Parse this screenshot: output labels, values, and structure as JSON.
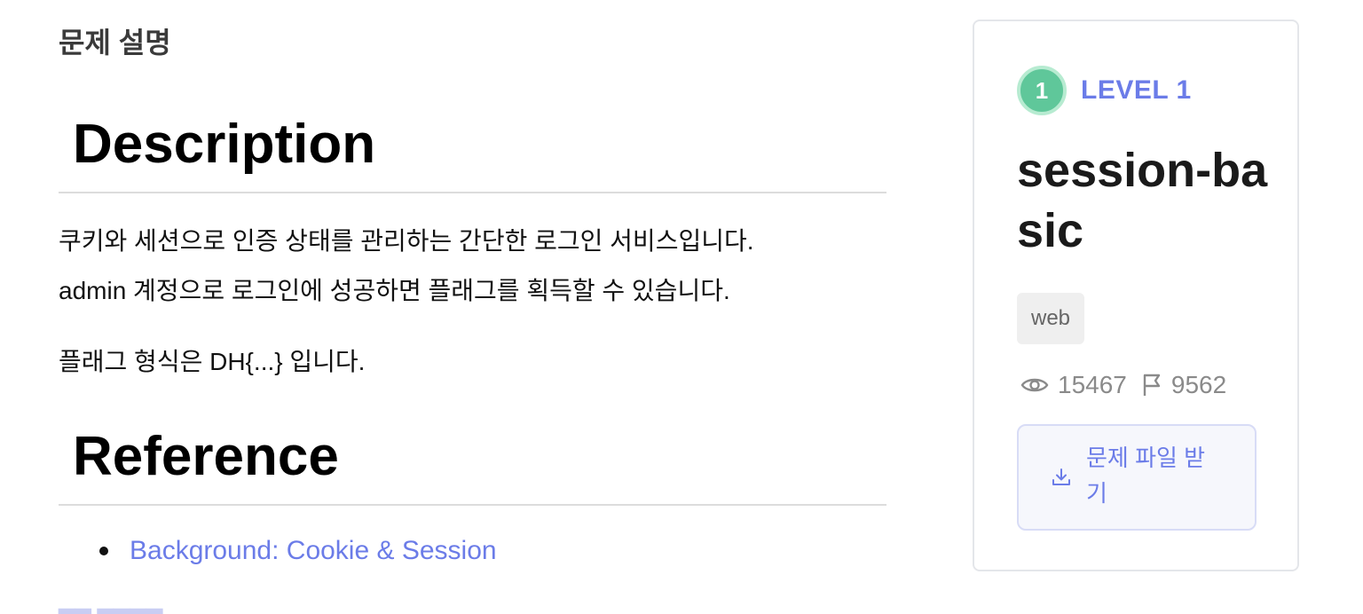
{
  "section_title": "문제 설명",
  "description": {
    "heading": "Description",
    "paragraph1": "쿠키와 세션으로 인증 상태를 관리하는 간단한 로그인 서비스입니다.",
    "paragraph2": "admin 계정으로 로그인에 성공하면 플래그를 획득할 수 있습니다.",
    "paragraph3": "플래그 형식은 DH{...} 입니다."
  },
  "reference": {
    "heading": "Reference",
    "links": [
      {
        "label": "Background: Cookie & Session"
      }
    ]
  },
  "card": {
    "level_number": "1",
    "level_label": "LEVEL 1",
    "title": "session-basic",
    "tag": "web",
    "views": "15467",
    "solves": "9562",
    "download_label": "문제 파일 받기"
  },
  "colors": {
    "accent": "#6b7ce8",
    "level_badge": "#5fc79a",
    "tag_bg": "#efefef",
    "button_bg": "#f6f7fc"
  },
  "icons": {
    "views": "eye-icon",
    "solves": "flag-icon",
    "download": "download-icon"
  }
}
